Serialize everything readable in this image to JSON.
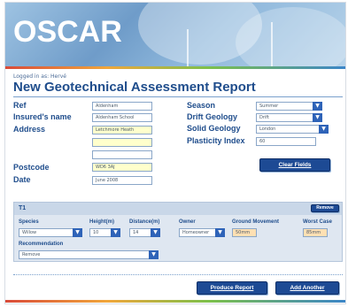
{
  "header": {
    "logo": "OSCAR",
    "logged_in": "Logged in as: Hervé",
    "title": "New Geotechnical Assessment Report"
  },
  "form": {
    "ref": {
      "label": "Ref",
      "value": "Aldenham"
    },
    "insured_name": {
      "label": "Insured's name",
      "value": "Aldenham School"
    },
    "address": {
      "label": "Address",
      "line1": "Letchmore Heath",
      "line2": "",
      "line3": ""
    },
    "postcode": {
      "label": "Postcode",
      "value": "WD6 3AJ"
    },
    "date": {
      "label": "Date",
      "value": "June 2008"
    },
    "season": {
      "label": "Season",
      "value": "Summer"
    },
    "drift_geology": {
      "label": "Drift Geology",
      "value": "Drift"
    },
    "solid_geology": {
      "label": "Solid Geology",
      "value": "London"
    },
    "plasticity_index": {
      "label": "Plasticity Index",
      "value": "60"
    },
    "clear_button": "Clear Fields"
  },
  "tree_panel": {
    "title": "T1",
    "remove_button": "Remove",
    "columns": {
      "species": "Species",
      "height": "Height(m)",
      "distance": "Distance(m)",
      "owner": "Owner",
      "ground_movement": "Ground Movement",
      "worst_case": "Worst Case"
    },
    "values": {
      "species": "Willow",
      "height": "10",
      "distance": "14",
      "owner": "Homeowner",
      "ground_movement": "50mm",
      "worst_case": "85mm"
    },
    "recommendation_label": "Recommendation",
    "recommendation_value": "Remove"
  },
  "footer": {
    "produce_report": "Produce Report",
    "add_another": "Add Another"
  }
}
